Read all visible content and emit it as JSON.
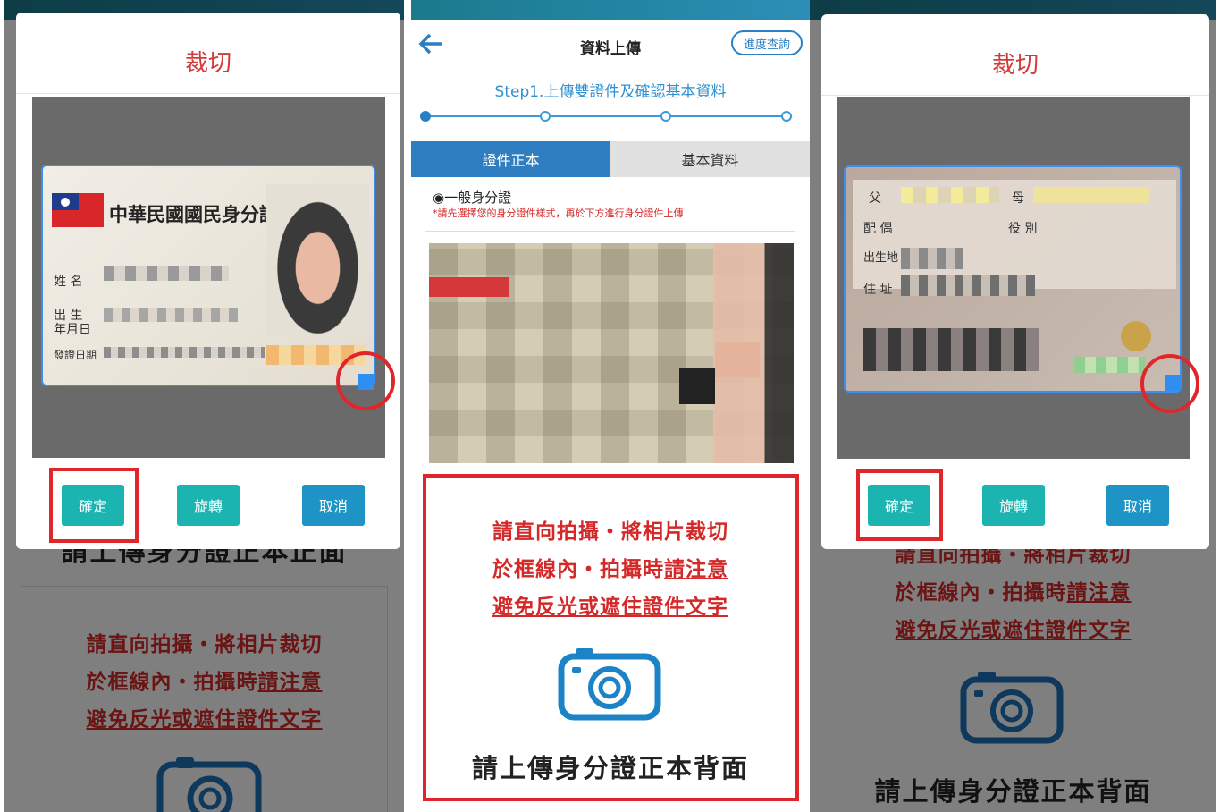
{
  "left": {
    "under_title": "請上傳身分證正本正面",
    "warn1": "請直向拍攝・將相片裁切",
    "warn2a": "於框線內・拍攝時",
    "warn2b": "請注意",
    "warn3": "避免反光或遮住證件文字",
    "modal": {
      "title": "裁切",
      "confirm": "確定",
      "rotate": "旋轉",
      "cancel": "取消"
    },
    "card": {
      "header": "中華民國國民身分證",
      "name": "姓 名",
      "birth1": "出 生",
      "birth2": "年月日",
      "issue": "發證日期"
    }
  },
  "center": {
    "title": "資料上傳",
    "progress_btn": "進度查詢",
    "step": "Step1.上傳雙證件及確認基本資料",
    "tab_active": "證件正本",
    "tab_inactive": "基本資料",
    "radio_label": "◉一般身分證",
    "hint": "*請先選擇您的身分證件樣式，再於下方進行身分證件上傳",
    "warn1": "請直向拍攝・將相片裁切",
    "warn2a": "於框線內・拍攝時",
    "warn2b": "請注意",
    "warn3": "避免反光或遮住證件文字",
    "upload_label": "請上傳身分證正本背面"
  },
  "right": {
    "under_title_partial": "請直向拍攝・將相片裁切",
    "warn2a": "於框線內・拍攝時",
    "warn2b": "請注意",
    "warn3": "避免反光或遮住證件文字",
    "upload_label": "請上傳身分證正本背面",
    "modal": {
      "title": "裁切",
      "confirm": "確定",
      "rotate": "旋轉",
      "cancel": "取消"
    },
    "card": {
      "father": "父",
      "mother": "母",
      "spouse": "配 偶",
      "military": "役 別",
      "birthplace": "出生地",
      "address": "住 址"
    }
  },
  "colors": {
    "accent_red": "#e0262b",
    "teal_button": "#1bb4b0",
    "blue_button": "#1d93c6",
    "tab_blue": "#2f7ec1",
    "crop_handle": "#2f8ef0"
  },
  "icons": [
    "back-arrow-icon",
    "camera-icon",
    "radio-icon"
  ]
}
